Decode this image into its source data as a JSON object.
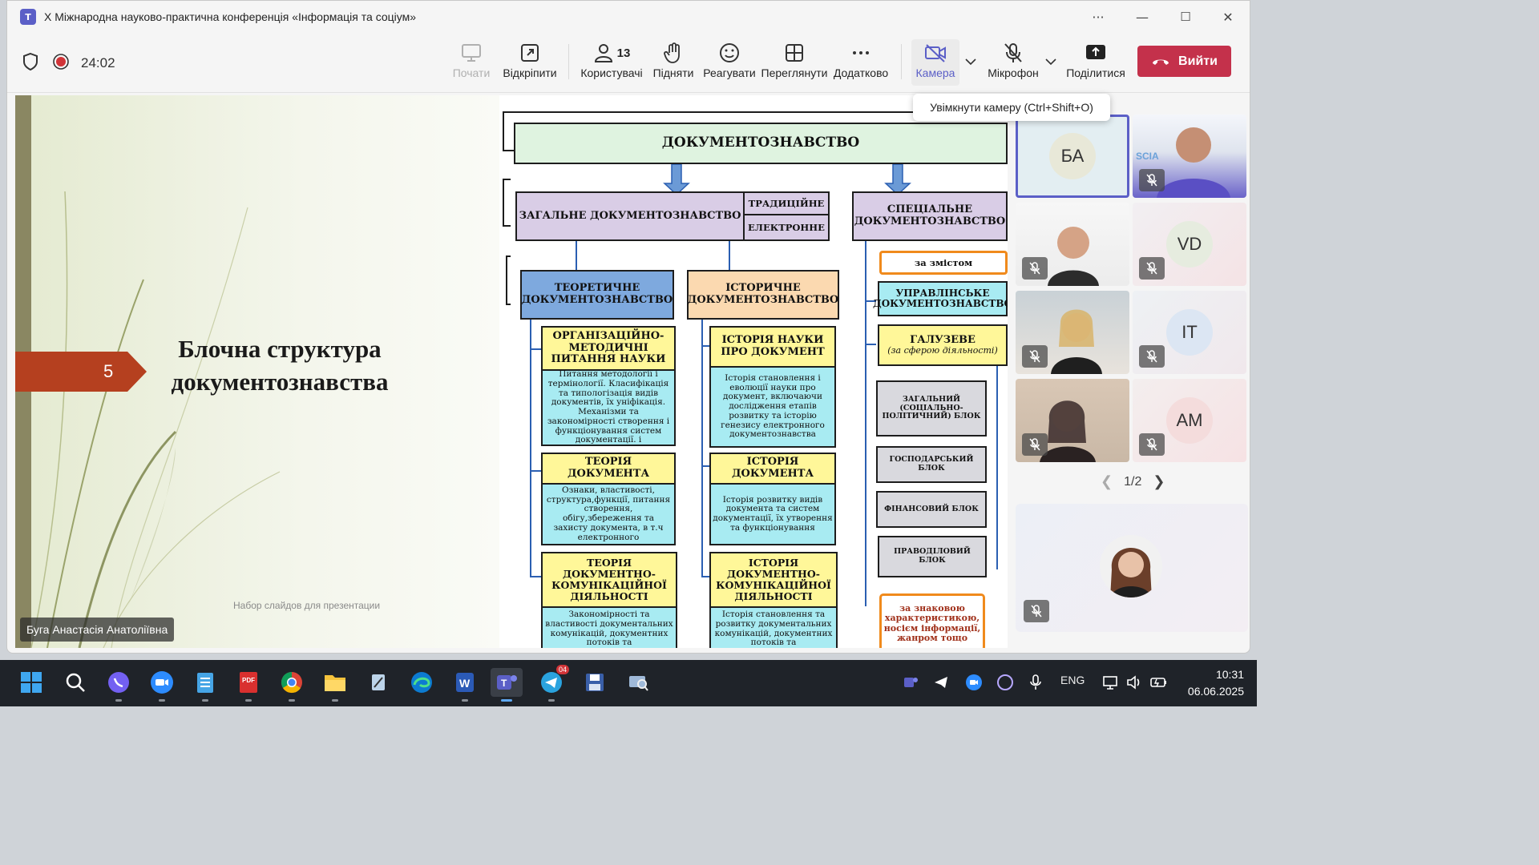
{
  "window": {
    "title": "X Міжнародна науково-практична конференція «Інформація та соціум»",
    "controls": {
      "more": "···",
      "minimize": "—",
      "maximize": "☐",
      "close": "✕"
    }
  },
  "toolbar": {
    "timer": "24:02",
    "buttons": {
      "start": "Почати",
      "popout": "Відкріпити",
      "people": "Користувачі",
      "people_count": "13",
      "raise": "Підняти",
      "react": "Реагувати",
      "view": "Переглянути",
      "more": "Додатково",
      "camera": "Камера",
      "mic": "Мікрофон",
      "share": "Поділитися"
    },
    "leave": "Вийти",
    "tooltip": "Увімкнути камеру (Ctrl+Shift+O)"
  },
  "slide": {
    "number": "5",
    "title_line1": "Блочна структура",
    "title_line2": "документознавства",
    "footer": "Набор слайдов для презентации",
    "presenter": "Буга Анастасія Анатоліївна"
  },
  "diagram": {
    "root": "ДОКУМЕНТОЗНАВСТВО",
    "general": "ЗАГАЛЬНЕ ДОКУМЕНТОЗНАВСТВО",
    "traditional": "ТРАДИЦІЙНЕ",
    "electronic": "ЕЛЕКТРОННЕ",
    "special": "СПЕЦІАЛЬНЕ ДОКУМЕНТОЗНАВСТВО",
    "theoretical": "ТЕОРЕТИЧНЕ ДОКУМЕНТОЗНАВСТВО",
    "historical": "ІСТОРИЧНЕ ДОКУМЕНТОЗНАВСТВО",
    "by_content": "за змістом",
    "managerial": "УПРАВЛІНСЬКЕ ДОКУМЕНТОЗНАВСТВО",
    "branch": "ГАЛУЗЕВЕ",
    "branch_note": "(за сферою діяльності)",
    "org_method": "ОРГАНІЗАЦІЙНО-МЕТОДИЧНІ ПИТАННЯ НАУКИ",
    "org_method_text": "Питання методології і термінології. Класифікація та типологізація видів документів, їх уніфікація. Механізми та закономірності створення і функціонування систем документації. і",
    "history_science": "ІСТОРІЯ НАУКИ ПРО ДОКУМЕНТ",
    "history_science_text": "Історія становлення і еволюції науки про документ, включаючи дослідження етапів розвитку та історію генезису електронного документознавства",
    "doc_theory": "ТЕОРІЯ ДОКУМЕНТА",
    "doc_theory_text": "Ознаки, властивості, структура,функції, питання створення, обігу,збереження та захисту документа, в т.ч електронного",
    "doc_history": "ІСТОРІЯ ДОКУМЕНТА",
    "doc_history_text": "Історія розвитку видів документа та систем документації, їх утворення та функціонування",
    "comm_theory": "ТЕОРІЯ ДОКУМЕНТНО-КОМУНІКАЦІЙНОЇ ДІЯЛЬНОСТІ",
    "comm_theory_text": "Закономірності та властивості документальних комунікацій, документних потоків та",
    "comm_history": "ІСТОРІЯ ДОКУМЕНТНО-КОМУНІКАЦІЙНОЇ ДІЯЛЬНОСТІ",
    "comm_history_text": "Історія становлення та розвитку документальних комунікацій, документних потоків та",
    "block_general": "ЗАГАЛЬНИЙ (СОЦІАЛЬНО-ПОЛІТИЧНИЙ) БЛОК",
    "block_economic": "ГОСПОДАРСЬКИЙ БЛОК",
    "block_financial": "ФІНАНСОВИЙ БЛОК",
    "block_legal": "ПРАВОДІЛОВИЙ БЛОК",
    "by_sign": "за знаковою характеристикою, носієм інформації, жанром тощо"
  },
  "participants": {
    "tiles": [
      {
        "initials": "БА"
      },
      {
        "initials": ""
      },
      {
        "initials": ""
      },
      {
        "initials": "VD"
      },
      {
        "initials": ""
      },
      {
        "initials": "IT"
      },
      {
        "initials": ""
      },
      {
        "initials": "AM"
      }
    ],
    "pager": "1/2"
  },
  "taskbar": {
    "lang": "ENG",
    "time": "10:31",
    "date": "06.06.2025",
    "telegram_badge": "04"
  },
  "colors": {
    "accent": "#5b5fc7",
    "leave": "#c4314b",
    "slide_number_bg": "#b5401f",
    "diagram_root": "#dff3e0",
    "diagram_purple": "#d9cde6",
    "diagram_blue": "#7ea9de",
    "diagram_orange": "#fbd9b0",
    "diagram_yellow": "#fff799",
    "diagram_cyan": "#a8ebf2",
    "diagram_gray": "#d9d9de"
  }
}
